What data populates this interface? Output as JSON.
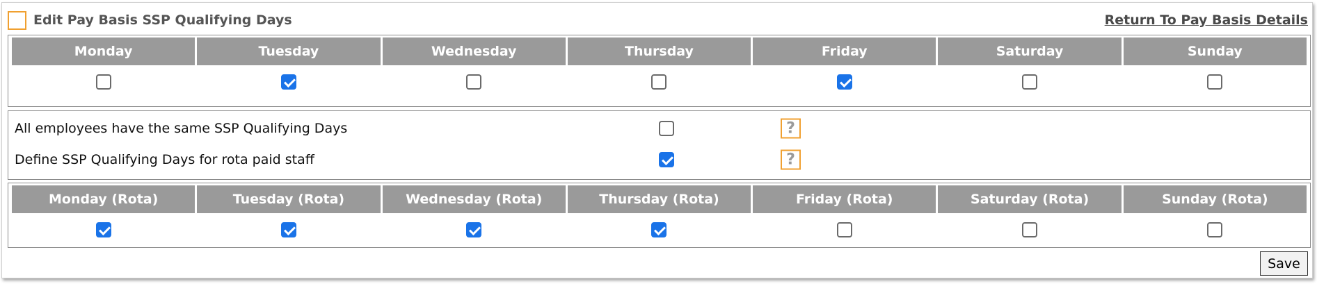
{
  "header": {
    "title": "Edit Pay Basis SSP Qualifying Days",
    "return_link": "Return To Pay Basis Details"
  },
  "qualifying_days": {
    "days": [
      {
        "label": "Monday",
        "checked": false
      },
      {
        "label": "Tuesday",
        "checked": true
      },
      {
        "label": "Wednesday",
        "checked": false
      },
      {
        "label": "Thursday",
        "checked": false
      },
      {
        "label": "Friday",
        "checked": true
      },
      {
        "label": "Saturday",
        "checked": false
      },
      {
        "label": "Sunday",
        "checked": false
      }
    ]
  },
  "settings": [
    {
      "label": "All employees have the same SSP Qualifying Days",
      "checked": false,
      "help_icon": "?"
    },
    {
      "label": "Define SSP Qualifying Days for rota paid staff",
      "checked": true,
      "help_icon": "?"
    }
  ],
  "rota_days": {
    "days": [
      {
        "label": "Monday (Rota)",
        "checked": true
      },
      {
        "label": "Tuesday (Rota)",
        "checked": true
      },
      {
        "label": "Wednesday (Rota)",
        "checked": true
      },
      {
        "label": "Thursday (Rota)",
        "checked": true
      },
      {
        "label": "Friday (Rota)",
        "checked": false
      },
      {
        "label": "Saturday (Rota)",
        "checked": false
      },
      {
        "label": "Sunday (Rota)",
        "checked": false
      }
    ]
  },
  "actions": {
    "save_label": "Save"
  },
  "colors": {
    "header_bg": "#9a9a9a",
    "accent_orange": "#f0a030",
    "checkbox_checked": "#1a73e8"
  }
}
